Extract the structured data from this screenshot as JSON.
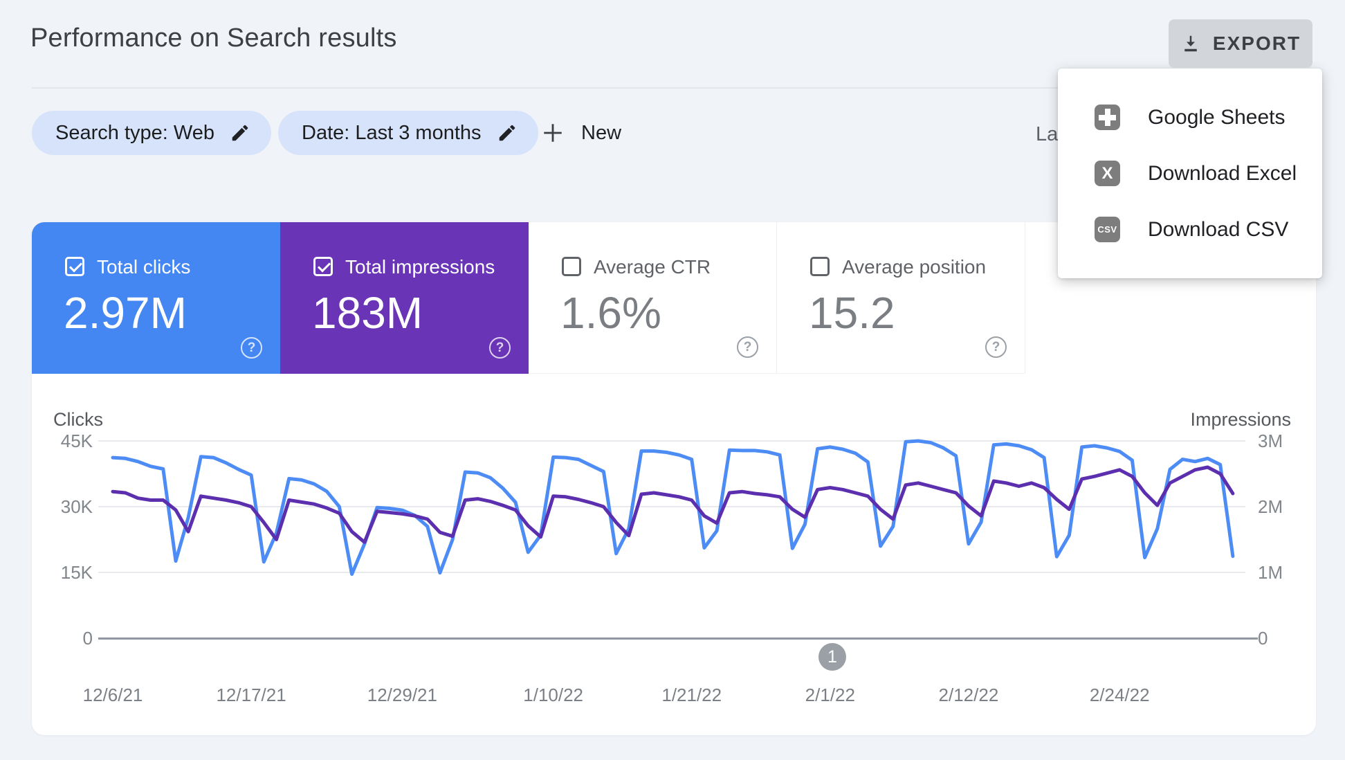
{
  "page": {
    "background": "#f0f3f8"
  },
  "header": {
    "title": "Performance on Search results",
    "export_label": "EXPORT",
    "last_updated_truncated": "La"
  },
  "filters": {
    "search_type_chip": "Search type: Web",
    "date_chip": "Date: Last 3 months",
    "new_label": "New"
  },
  "export_menu": {
    "items": [
      {
        "id": "google-sheets",
        "label": "Google Sheets",
        "icon": "sheets-cross-icon"
      },
      {
        "id": "download-excel",
        "label": "Download Excel",
        "icon": "letter-x-icon",
        "icon_text": "X"
      },
      {
        "id": "download-csv",
        "label": "Download CSV",
        "icon": "csv-badge-icon",
        "icon_text": "CSV"
      }
    ]
  },
  "metrics": [
    {
      "label": "Total clicks",
      "value": "2.97M",
      "checked": true,
      "color": "#4486f2"
    },
    {
      "label": "Total impressions",
      "value": "183M",
      "checked": true,
      "color": "#6a34b6"
    },
    {
      "label": "Average CTR",
      "value": "1.6%",
      "checked": false
    },
    {
      "label": "Average position",
      "value": "15.2",
      "checked": false
    }
  ],
  "pagination": {
    "current_page": "1"
  },
  "chart_data": {
    "type": "line",
    "grid": true,
    "left_axis": {
      "title": "Clicks",
      "max": 45000,
      "ticks": [
        "45K",
        "30K",
        "15K",
        "0"
      ]
    },
    "right_axis": {
      "title": "Impressions",
      "max": 3000000,
      "ticks": [
        "3M",
        "2M",
        "1M",
        "0"
      ]
    },
    "x_ticks": [
      {
        "label": "12/6/21",
        "day": 0
      },
      {
        "label": "12/17/21",
        "day": 11
      },
      {
        "label": "12/29/21",
        "day": 23
      },
      {
        "label": "1/10/22",
        "day": 35
      },
      {
        "label": "1/21/22",
        "day": 46
      },
      {
        "label": "2/1/22",
        "day": 57
      },
      {
        "label": "2/12/22",
        "day": 68
      },
      {
        "label": "2/24/22",
        "day": 80
      }
    ],
    "series": [
      {
        "name": "Clicks",
        "axis": "left",
        "color": "#4d8cf5",
        "values": [
          41200,
          41000,
          40300,
          39200,
          38600,
          17600,
          27500,
          41400,
          41200,
          40000,
          38500,
          37200,
          17400,
          24000,
          36400,
          36100,
          35200,
          33500,
          30000,
          14600,
          21500,
          29800,
          29600,
          29200,
          28000,
          25500,
          14900,
          22500,
          37900,
          37700,
          36600,
          34200,
          31000,
          19600,
          23500,
          41300,
          41200,
          40800,
          39400,
          38000,
          19300,
          25000,
          42700,
          42700,
          42400,
          41800,
          40800,
          20600,
          24500,
          42900,
          42800,
          42800,
          42500,
          41800,
          20500,
          26000,
          43200,
          43600,
          43100,
          42200,
          40200,
          21000,
          25500,
          44800,
          45000,
          44600,
          43400,
          41600,
          21500,
          26500,
          44100,
          44300,
          43900,
          43000,
          41200,
          18600,
          23500,
          43600,
          43900,
          43400,
          42600,
          40600,
          18400,
          25000,
          38500,
          40800,
          40300,
          41000,
          39600,
          18700
        ]
      },
      {
        "name": "Impressions",
        "axis": "right",
        "color": "#5b2fae",
        "values": [
          2230000,
          2210000,
          2130000,
          2100000,
          2100000,
          1950000,
          1620000,
          2160000,
          2130000,
          2100000,
          2060000,
          2000000,
          1760000,
          1500000,
          2100000,
          2070000,
          2040000,
          1980000,
          1900000,
          1620000,
          1460000,
          1930000,
          1910000,
          1890000,
          1860000,
          1810000,
          1610000,
          1550000,
          2100000,
          2120000,
          2080000,
          2020000,
          1950000,
          1710000,
          1540000,
          2160000,
          2150000,
          2110000,
          2060000,
          2000000,
          1760000,
          1560000,
          2190000,
          2210000,
          2180000,
          2150000,
          2100000,
          1860000,
          1750000,
          2210000,
          2230000,
          2200000,
          2180000,
          2150000,
          1960000,
          1840000,
          2260000,
          2290000,
          2260000,
          2210000,
          2160000,
          1960000,
          1810000,
          2330000,
          2360000,
          2310000,
          2260000,
          2210000,
          2010000,
          1860000,
          2390000,
          2360000,
          2310000,
          2360000,
          2290000,
          2110000,
          1960000,
          2420000,
          2460000,
          2510000,
          2560000,
          2460000,
          2210000,
          2020000,
          2360000,
          2460000,
          2560000,
          2600000,
          2500000,
          2200000
        ]
      }
    ]
  }
}
